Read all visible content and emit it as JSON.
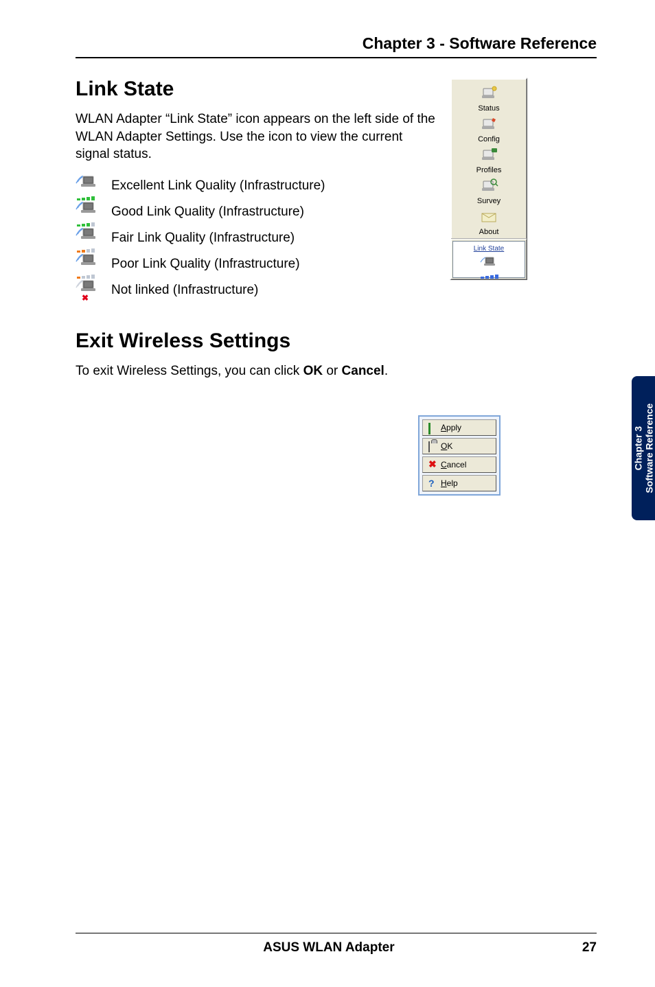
{
  "header": {
    "chapter_title": "Chapter 3 - Software Reference"
  },
  "link_state": {
    "title": "Link State",
    "intro": "WLAN Adapter “Link State” icon appears on the left side of the WLAN Adapter Settings. Use the icon to view the current signal status.",
    "rows": [
      {
        "label": "Excellent Link Quality (Infrastructure)"
      },
      {
        "label": "Good Link Quality (Infrastructure)"
      },
      {
        "label": "Fair Link Quality (Infrastructure)"
      },
      {
        "label": "Poor Link Quality (Infrastructure)"
      },
      {
        "label": "Not linked (Infrastructure)"
      }
    ]
  },
  "sidebar": {
    "items": [
      {
        "label": "Status"
      },
      {
        "label": "Config"
      },
      {
        "label": "Profiles"
      },
      {
        "label": "Survey"
      },
      {
        "label": "About"
      }
    ],
    "link_state_label": "Link State"
  },
  "exit": {
    "title": "Exit Wireless Settings",
    "text_before": "To exit Wireless Settings, you can click ",
    "ok": "OK",
    "or": " or ",
    "cancel": "Cancel",
    "period": "."
  },
  "buttons": {
    "apply": {
      "u": "A",
      "rest": "pply"
    },
    "ok": {
      "u": "O",
      "rest": "K"
    },
    "cancel": {
      "u": "C",
      "rest": "ancel"
    },
    "help": {
      "u": "H",
      "rest": "elp"
    }
  },
  "side_tab": {
    "line1": "Chapter 3",
    "line2": "Software Reference"
  },
  "footer": {
    "title": "ASUS WLAN Adapter",
    "page": "27"
  }
}
